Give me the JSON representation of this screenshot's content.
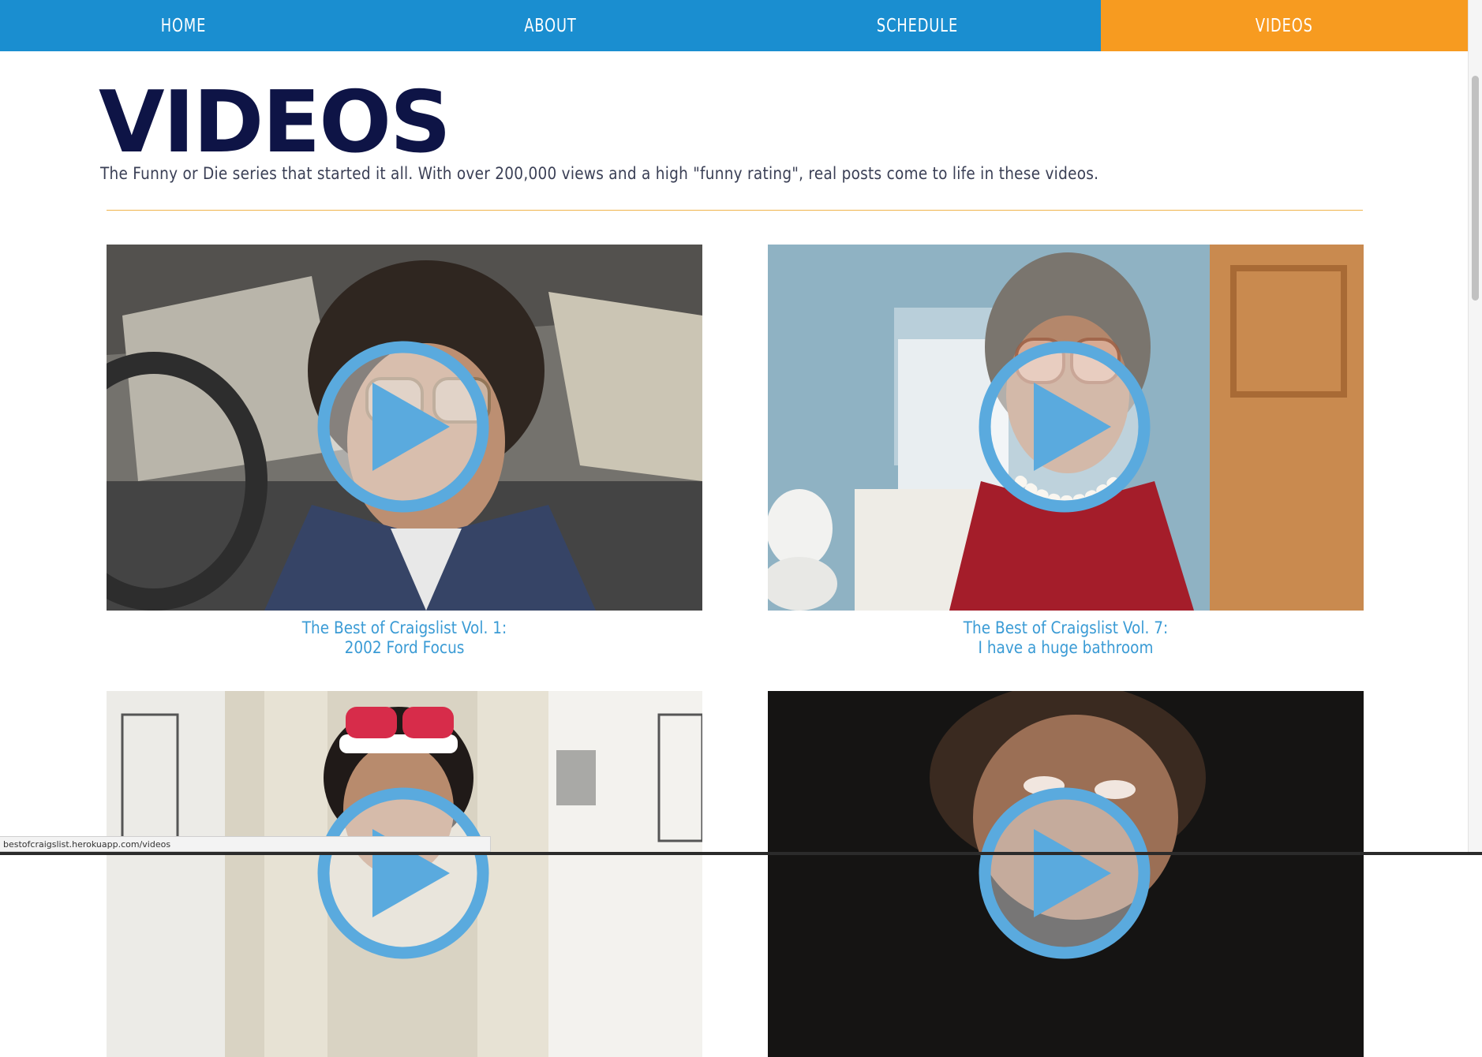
{
  "nav": {
    "items": [
      {
        "label": "HOME"
      },
      {
        "label": "ABOUT"
      },
      {
        "label": "SCHEDULE"
      },
      {
        "label": "VIDEOS"
      }
    ],
    "active": "VIDEOS"
  },
  "header": {
    "title": "VIDEOS",
    "subtitle": "The Funny or Die series that started it all. With over 200,000 views and a high \"funny rating\", real posts come to life in these videos."
  },
  "videos": [
    {
      "caption_line1": "The Best of Craigslist Vol. 1:",
      "caption_line2": "2002 Ford Focus"
    },
    {
      "caption_line1": "The Best of Craigslist Vol. 7:",
      "caption_line2": "I have a huge bathroom"
    },
    {
      "caption_line1": "",
      "caption_line2": ""
    },
    {
      "caption_line1": "",
      "caption_line2": ""
    }
  ],
  "status_bar": {
    "url": "bestofcraigslist.herokuapp.com/videos"
  },
  "colors": {
    "nav_blue": "#1a8ed0",
    "nav_active": "#f79b20",
    "title": "#0e1446",
    "caption": "#3a9bd5",
    "divider": "#f0b44c",
    "play_button": "#5aaade"
  },
  "icons": {
    "play": "play-icon"
  }
}
